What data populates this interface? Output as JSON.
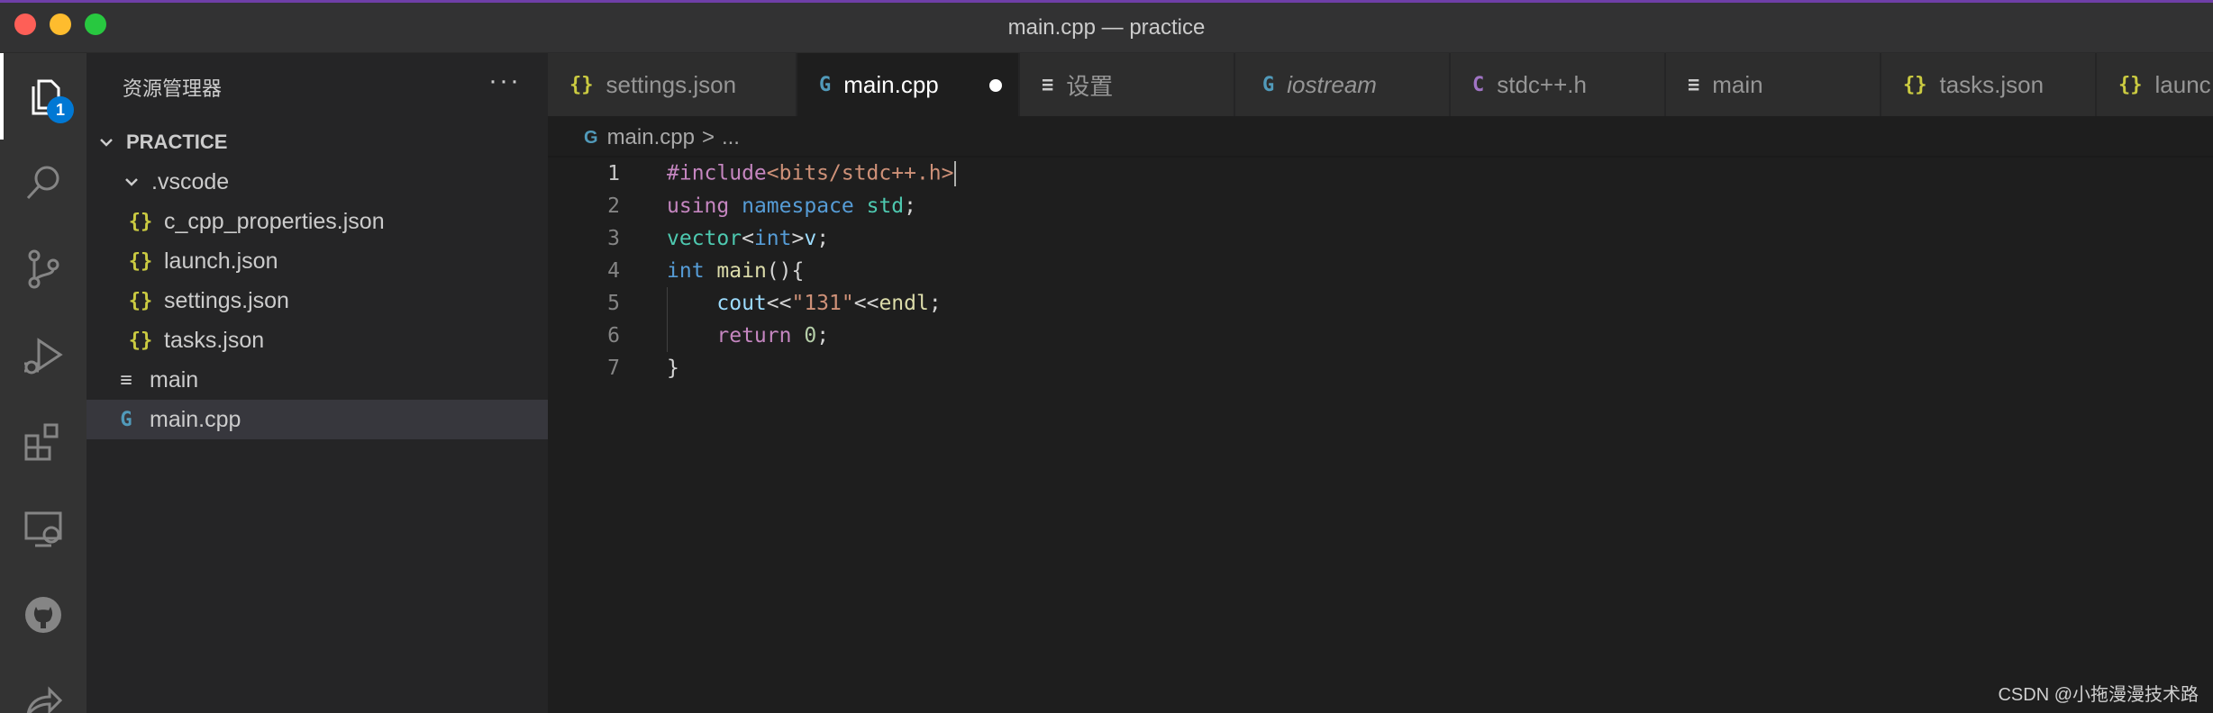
{
  "window": {
    "title": "main.cpp — practice"
  },
  "activity_bar": {
    "items": [
      {
        "name": "explorer-icon",
        "active": true,
        "badge": "1"
      },
      {
        "name": "search-icon"
      },
      {
        "name": "source-control-icon"
      },
      {
        "name": "run-debug-icon"
      },
      {
        "name": "extensions-icon"
      },
      {
        "name": "remote-explorer-icon"
      },
      {
        "name": "github-icon"
      },
      {
        "name": "live-share-icon"
      }
    ]
  },
  "sidebar": {
    "header": "资源管理器",
    "more": "···",
    "section_title": "PRACTICE",
    "tree": [
      {
        "label": ".vscode",
        "type": "folder",
        "expanded": true
      },
      {
        "label": "c_cpp_properties.json",
        "type": "json"
      },
      {
        "label": "launch.json",
        "type": "json"
      },
      {
        "label": "settings.json",
        "type": "json"
      },
      {
        "label": "tasks.json",
        "type": "json"
      },
      {
        "label": "main",
        "type": "text"
      },
      {
        "label": "main.cpp",
        "type": "cpp",
        "selected": true
      }
    ]
  },
  "tabs": [
    {
      "label": "settings.json",
      "icon": "{}",
      "icon_type": "json"
    },
    {
      "label": "main.cpp",
      "icon": "G",
      "icon_type": "cpp",
      "active": true,
      "dirty": true
    },
    {
      "label": "设置",
      "icon": "≡",
      "icon_type": "text"
    },
    {
      "label": "iostream",
      "icon": "G",
      "icon_type": "cpp",
      "italic": true
    },
    {
      "label": "stdc++.h",
      "icon": "C",
      "icon_type": "c"
    },
    {
      "label": "main",
      "icon": "≡",
      "icon_type": "text"
    },
    {
      "label": "tasks.json",
      "icon": "{}",
      "icon_type": "json"
    },
    {
      "label": "launc",
      "icon": "{}",
      "icon_type": "json"
    }
  ],
  "breadcrumb": {
    "file": "main.cpp",
    "separator": ">",
    "rest": "..."
  },
  "editor": {
    "lines": [
      {
        "n": "1",
        "current": true
      },
      {
        "n": "2"
      },
      {
        "n": "3"
      },
      {
        "n": "4"
      },
      {
        "n": "5"
      },
      {
        "n": "6"
      },
      {
        "n": "7"
      }
    ],
    "tokens": {
      "l1_include": "#include",
      "l1_path": "<bits/stdc++.h>",
      "l2_using": "using",
      "l2_namespace": "namespace",
      "l2_std": "std",
      "l2_semi": ";",
      "l3_vector": "vector",
      "l3_lt": "<",
      "l3_int": "int",
      "l3_gt": ">",
      "l3_v": "v",
      "l3_semi": ";",
      "l4_int": "int",
      "l4_main": "main",
      "l4_rest": "(){",
      "l5_cout": "cout",
      "l5_op1": "<<",
      "l5_str": "\"131\"",
      "l5_op2": "<<",
      "l5_endl": "endl",
      "l5_semi": ";",
      "l6_return": "return",
      "l6_zero": "0",
      "l6_semi": ";",
      "l7_brace": "}"
    }
  },
  "watermark": "CSDN @小拖漫漫技术路",
  "colors": {
    "accent": "#0078d4",
    "keyword": "#569cd6",
    "preprocessor": "#c586c0",
    "string": "#ce9178",
    "type": "#4ec9b0",
    "function": "#dcdcaa",
    "variable": "#9cdcfe",
    "number": "#b5cea8"
  }
}
